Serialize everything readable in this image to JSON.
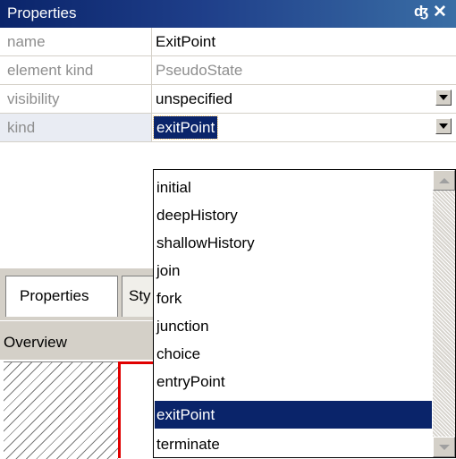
{
  "window": {
    "title": "Properties",
    "pin_icon": "p",
    "close_icon": "✕"
  },
  "properties": [
    {
      "key": "name",
      "value": "ExitPoint"
    },
    {
      "key": "element kind",
      "value": "PseudoState"
    },
    {
      "key": "visibility",
      "value": "unspecified"
    },
    {
      "key": "kind",
      "value": "exitPoint"
    }
  ],
  "tabs": {
    "properties": "Properties",
    "styles": "Sty",
    "overview": "Overview"
  },
  "dropdown": {
    "options": [
      "initial",
      "deepHistory",
      "shallowHistory",
      "join",
      "fork",
      "junction",
      "choice",
      "entryPoint",
      "exitPoint",
      "terminate"
    ],
    "selected": "exitPoint"
  },
  "colors": {
    "title_bar": "#0a246a",
    "selection": "#0a246a",
    "frame_red": "#e00000"
  }
}
